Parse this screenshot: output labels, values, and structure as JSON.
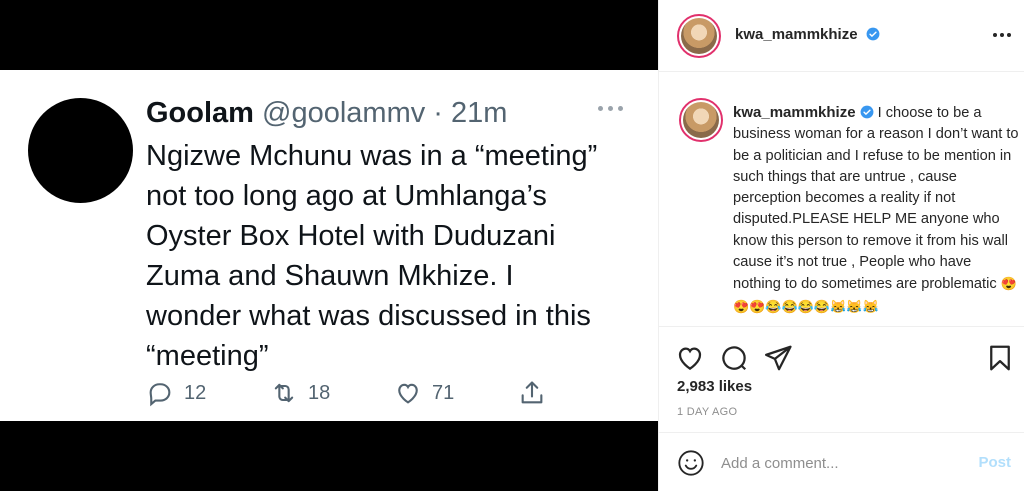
{
  "tweet": {
    "name": "Goolam",
    "handle": "@goolammv",
    "separator": " · ",
    "time": "21m",
    "text": "Ngizwe Mchunu was in a “meeting”\nnot too long ago at Umhlanga’s\nOyster Box Hotel with Duduzani\nZuma and Shauwn Mkhize. I\nwonder what was discussed in this\n“meeting”",
    "replies": "12",
    "retweets": "18",
    "likes": "71"
  },
  "post": {
    "username": "kwa_mammkhize",
    "caption_username": "kwa_mammkhize",
    "caption_text": "I choose to be a business woman for a reason I don’t want to be a politician and I refuse to be mention in such things that are untrue , cause perception becomes a reality if not disputed.PLEASE HELP ME anyone who know this person to remove it from his wall cause it’s not true , People who have nothing to do sometimes are problematic ",
    "caption_emoji": "😍😍😍😂😂😂😂😹😹😹",
    "likes_count": "2,983 likes",
    "date": "1 DAY AGO",
    "comment_placeholder": "Add a comment...",
    "post_label": "Post"
  },
  "colors": {
    "verified": "#3897f0",
    "post_disabled": "#b2dffc",
    "story_ring": "#e1306c"
  },
  "icons": [
    "verified-badge-icon",
    "more-options-icon",
    "heart-icon",
    "comment-icon",
    "share-icon",
    "bookmark-icon",
    "emoji-icon",
    "reply-icon",
    "retweet-icon",
    "like-icon",
    "upload-icon"
  ]
}
